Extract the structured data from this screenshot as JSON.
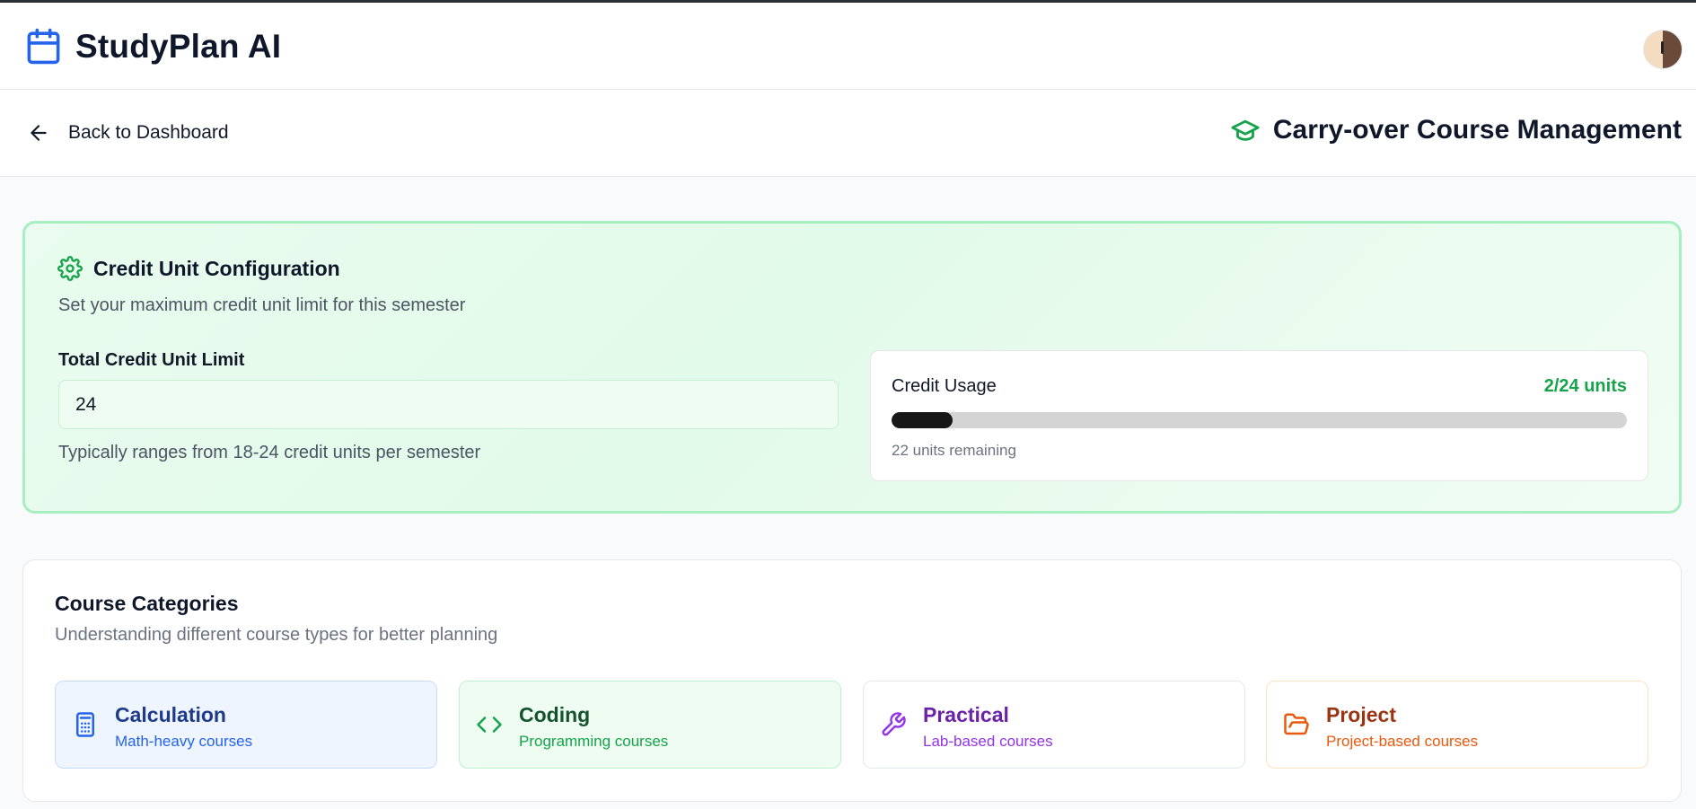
{
  "app": {
    "name": "StudyPlan AI"
  },
  "nav": {
    "back_label": "Back to Dashboard",
    "page_title": "Carry-over Course Management"
  },
  "credit_config": {
    "title": "Credit Unit Configuration",
    "subtitle": "Set your maximum credit unit limit for this semester",
    "limit_label": "Total Credit Unit Limit",
    "limit_value": "24",
    "limit_help": "Typically ranges from 18-24 credit units per semester",
    "usage": {
      "label": "Credit Usage",
      "value_text": "2/24 units",
      "used": 2,
      "total": 24,
      "remaining_text": "22 units remaining"
    }
  },
  "categories": {
    "title": "Course Categories",
    "subtitle": "Understanding different course types for better planning",
    "items": [
      {
        "name": "Calculation",
        "desc": "Math-heavy courses",
        "icon": "calculator-icon"
      },
      {
        "name": "Coding",
        "desc": "Programming courses",
        "icon": "code-icon"
      },
      {
        "name": "Practical",
        "desc": "Lab-based courses",
        "icon": "wrench-icon"
      },
      {
        "name": "Project",
        "desc": "Project-based courses",
        "icon": "folder-open-icon"
      }
    ]
  },
  "colors": {
    "brand_blue": "#2563eb",
    "accent_green": "#16a34a",
    "calculation": "#2563eb",
    "coding": "#16a34a",
    "practical": "#9333ea",
    "project": "#ea580c"
  }
}
